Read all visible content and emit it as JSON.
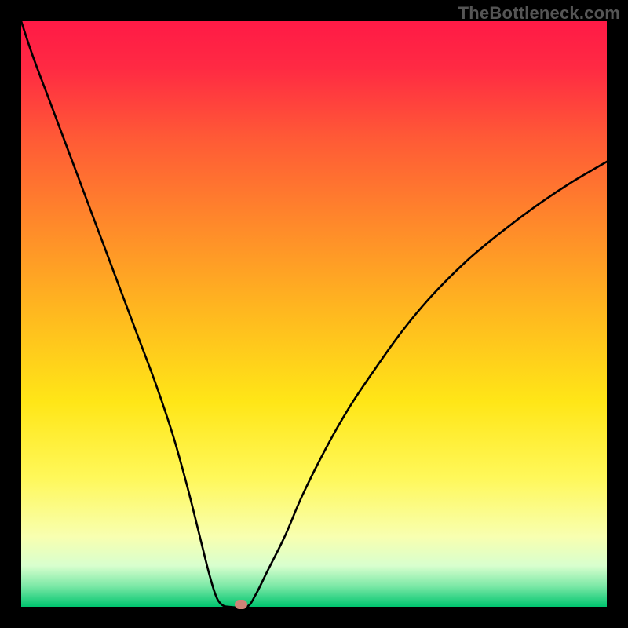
{
  "watermark": "TheBottleneck.com",
  "chart_data": {
    "type": "line",
    "title": "",
    "xlabel": "",
    "ylabel": "",
    "xlim": [
      0,
      100
    ],
    "ylim": [
      0,
      100
    ],
    "background_gradient": {
      "stops": [
        {
          "offset": 0.0,
          "color": "#ff1a46"
        },
        {
          "offset": 0.08,
          "color": "#ff2a43"
        },
        {
          "offset": 0.2,
          "color": "#ff5a36"
        },
        {
          "offset": 0.35,
          "color": "#ff8a2a"
        },
        {
          "offset": 0.5,
          "color": "#ffb91f"
        },
        {
          "offset": 0.65,
          "color": "#ffe617"
        },
        {
          "offset": 0.78,
          "color": "#fff85a"
        },
        {
          "offset": 0.88,
          "color": "#f8ffb0"
        },
        {
          "offset": 0.93,
          "color": "#d8ffce"
        },
        {
          "offset": 0.965,
          "color": "#7be8a6"
        },
        {
          "offset": 1.0,
          "color": "#00c56f"
        }
      ]
    },
    "series": [
      {
        "name": "bottleneck-curve",
        "x": [
          0,
          2,
          5,
          8,
          11,
          14,
          17,
          20,
          23,
          26,
          28.5,
          30.5,
          32,
          33.2,
          34.2,
          35.5,
          38.5,
          40,
          42,
          45,
          48,
          52,
          56,
          60,
          65,
          70,
          76,
          82,
          88,
          94,
          100
        ],
        "y": [
          100,
          94,
          86,
          78,
          70,
          62,
          54,
          46,
          38,
          29,
          20,
          12,
          6,
          2,
          0.4,
          0,
          0,
          2,
          6,
          12,
          19,
          27,
          34,
          40,
          47,
          53,
          59,
          64,
          68.5,
          72.5,
          76
        ]
      }
    ],
    "marker": {
      "x": 37.5,
      "y": 0.4,
      "label": "optimal-point"
    },
    "curve_color": "#000000",
    "curve_width": 2.6
  }
}
